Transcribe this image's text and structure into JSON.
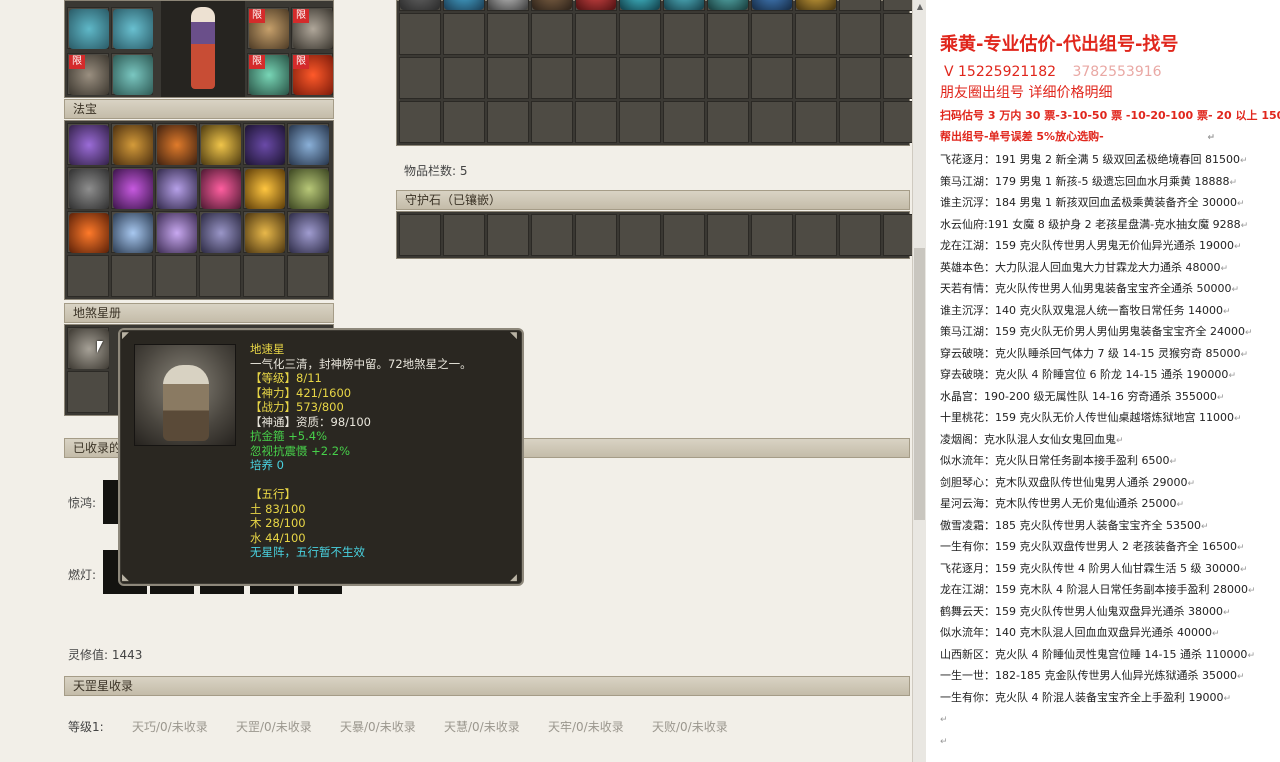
{
  "left_panel": {
    "limit_badge": "限",
    "fabao_header": "法宝",
    "disha_header": "地煞星册",
    "collected_header": "已收录的",
    "row_labels": {
      "jinghong": "惊鸿:",
      "randeng": "燃灯:"
    },
    "lingxiu_label": "灵修值:",
    "lingxiu_value": "1443",
    "tiangang_header": "天罡星收录",
    "level_label": "等级1:",
    "tiangang_items": [
      "天巧/0/未收录",
      "天罡/0/未收录",
      "天暴/0/未收录",
      "天慧/0/未收录",
      "天牢/0/未收录",
      "天败/0/未收录"
    ]
  },
  "right_panel": {
    "item_count_label": "物品栏数:",
    "item_count_value": "5",
    "guard_stone_header": "守护石（已镶嵌）"
  },
  "tooltip": {
    "name": "地速星",
    "desc": "一气化三清，封神榜中留。72地煞星之一。",
    "level": "【等级】8/11",
    "shenli": "【神力】421/1600",
    "zhanli": "【战力】573/800",
    "shentong": "【神通】资质：98/100",
    "attr1": "抗金箍 +5.4%",
    "attr2": "忽视抗震慑 +2.2%",
    "peiyang": "培养 0",
    "wuxing_title": "【五行】",
    "earth": "土 83/100",
    "wood": "木 28/100",
    "water": "水 44/100",
    "no_formation": "无星阵，五行暂不生效"
  },
  "notes": {
    "title": "乘黄-专业估价-代出组号-找号",
    "phone": "V 15225921182",
    "phone_overlay": "3782553916",
    "line2": "朋友圈出组号    详细价格明细",
    "line3": "扫码估号 3 万内 30 票-3-10-50 票 -10-20-100 票- 20 以上 150",
    "line4": "帮出组号-单号误差 5%放心选购-",
    "pilcrow": "↵",
    "entries": [
      "飞花逐月：191 男鬼 2 新全满 5 级双回孟极绝境春回 81500",
      "策马江湖：179 男鬼 1 新孩-5 级遗忘回血水月乘黄 18888",
      "谁主沉浮：184 男鬼 1 新孩双回血孟极乘黄装备齐全 30000",
      "水云仙府:191 女魔 8 级护身 2 老孩星盘满-克水抽女魔 9288",
      "龙在江湖：159 克火队传世男人男鬼无价仙异光通杀 19000",
      "英雄本色：大力队混人回血鬼大力甘霖龙大力通杀 48000",
      "天若有情：克火队传世男人仙男鬼装备宝宝齐全通杀 50000",
      "谁主沉浮：140 克火队双鬼混人统一畜牧日常任务 14000",
      "策马江湖：159 克火队无价男人男仙男鬼装备宝宝齐全 24000",
      "穿云破晓：克火队睡杀回气体力 7 级 14-15 灵猴穷奇 85000",
      "穿去破晓：克火队 4 阶睡宫位 6 阶龙 14-15 通杀 190000",
      "水晶宫：190-200 级无属性队 14-16 穷奇通杀 355000",
      "十里桃花：159 克火队无价人传世仙桌越塔炼狱地宫 11000",
      "凌烟阁：克水队混人女仙女鬼回血鬼",
      "似水流年：克火队日常任务副本接手盈利 6500",
      "剑胆琴心：克木队双盘队传世仙鬼男人通杀 29000",
      "星河云海：克木队传世男人无价鬼仙通杀 25000",
      "傲雪凌霜：185 克火队传世男人装备宝宝齐全 53500",
      "一生有你：159 克火队双盘传世男人 2 老孩装备齐全 16500",
      "飞花逐月：159 克火队传世 4 阶男人仙甘霖生活 5 级 30000",
      "龙在江湖：159 克木队 4 阶混人日常任务副本接手盈利 28000",
      "鹤舞云天：159 克火队传世男人仙鬼双盘异光通杀 38000",
      "似水流年：140 克木队混人回血血双盘异光通杀 40000",
      "山西新区：克火队 4 阶睡仙灵性鬼宫位睡 14-15 通杀 110000",
      "一生一世：182-185 克金队传世男人仙异光炼狱通杀 35000",
      "一生有你：克火队 4 阶混人装备宝宝齐全上手盈利 19000"
    ]
  }
}
